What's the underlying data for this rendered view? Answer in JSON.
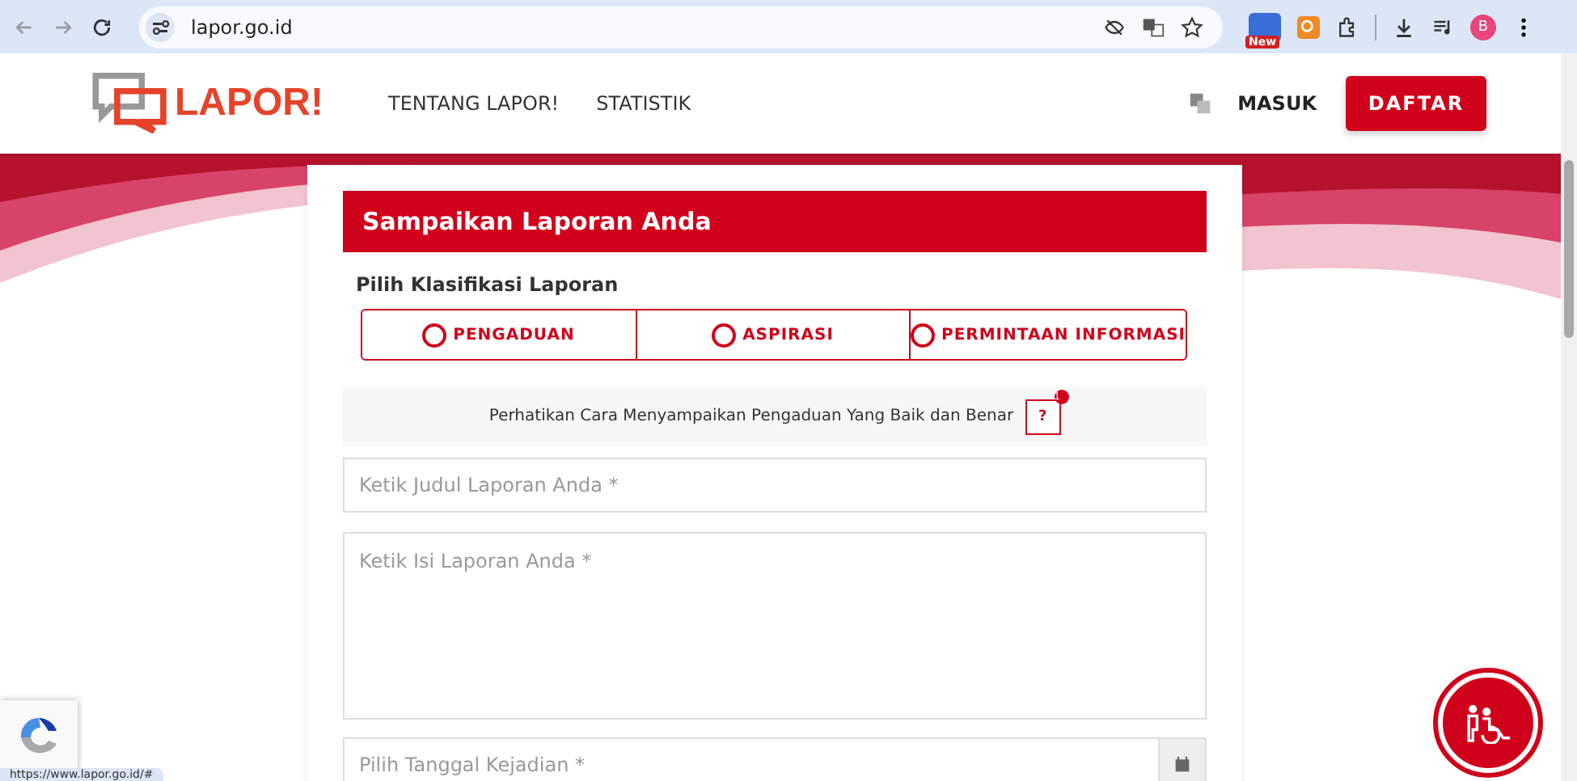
{
  "browser": {
    "url": "lapor.go.id",
    "extension_badge": "New",
    "profile_initial": "B"
  },
  "header": {
    "logo_text": "LAPOR!",
    "nav": [
      "TENTANG LAPOR!",
      "STATISTIK"
    ],
    "login": "MASUK",
    "register": "DAFTAR"
  },
  "form": {
    "title": "Sampaikan Laporan Anda",
    "classification_label": "Pilih Klasifikasi Laporan",
    "options": [
      {
        "label": "PENGADUAN",
        "selected": false
      },
      {
        "label": "ASPIRASI",
        "selected": false
      },
      {
        "label": "PERMINTAAN INFORMASI",
        "selected": false
      }
    ],
    "notice": {
      "text": "Perhatikan Cara Menyampaikan Pengaduan Yang Baik dan Benar",
      "help": "?",
      "badge": "1"
    },
    "fields": [
      {
        "kind": "input",
        "placeholder": "Ketik Judul Laporan Anda *"
      },
      {
        "kind": "textarea",
        "placeholder": "Ketik Isi Laporan Anda *"
      },
      {
        "kind": "date",
        "placeholder": "Pilih Tanggal Kejadian *"
      }
    ]
  },
  "status_url": "https://www.lapor.go.id/#"
}
